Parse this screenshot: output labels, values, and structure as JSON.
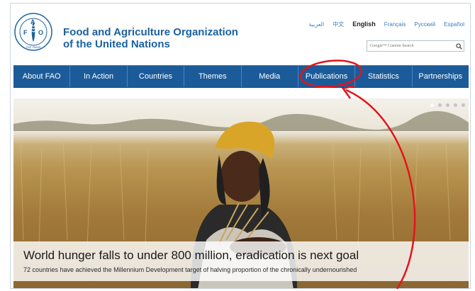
{
  "header": {
    "org_name_line1": "Food and Agriculture Organization",
    "org_name_line2": "of the United Nations",
    "logo_letters": [
      "F",
      "A",
      "O"
    ],
    "logo_motto": "FIAT PANIS"
  },
  "languages": [
    {
      "label": "العربية",
      "active": false
    },
    {
      "label": "中文",
      "active": false
    },
    {
      "label": "English",
      "active": true
    },
    {
      "label": "Français",
      "active": false
    },
    {
      "label": "Русский",
      "active": false
    },
    {
      "label": "Español",
      "active": false
    }
  ],
  "search": {
    "placeholder": "Google™ Custom Search",
    "icon": "search-icon"
  },
  "nav": {
    "items": [
      {
        "label": "About FAO"
      },
      {
        "label": "In Action"
      },
      {
        "label": "Countries"
      },
      {
        "label": "Themes"
      },
      {
        "label": "Media"
      },
      {
        "label": "Publications"
      },
      {
        "label": "Statistics"
      },
      {
        "label": "Partnerships"
      }
    ]
  },
  "hero": {
    "headline": "World hunger falls to under 800 million, eradication is next goal",
    "subline": "72 countries have achieved the Millennium Development target of halving proportion of the chronically undernourished",
    "slide_count": 5,
    "active_slide": 1
  },
  "colors": {
    "brand_blue": "#1b61a0",
    "nav_bg": "#1c5b99",
    "annotation_red": "#e3141b"
  }
}
